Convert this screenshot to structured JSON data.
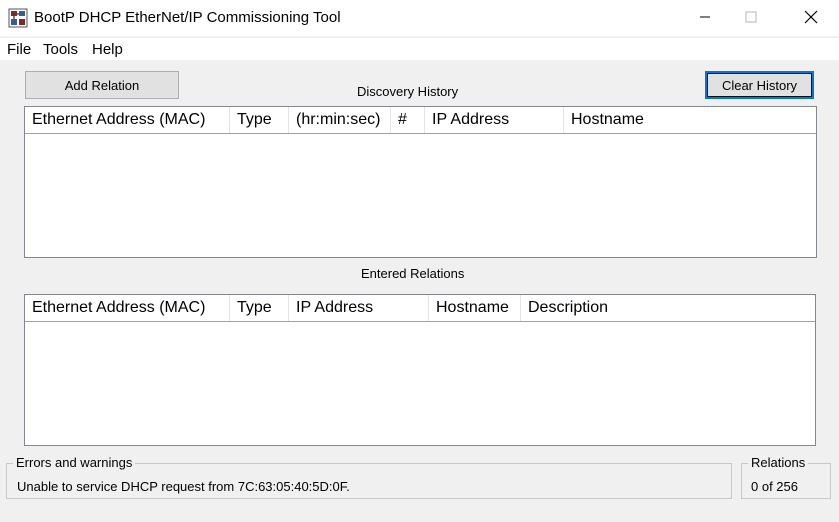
{
  "window": {
    "title": "BootP DHCP EtherNet/IP Commissioning Tool",
    "controls": {
      "minimize": "minimize-icon",
      "maximize": "maximize-icon",
      "close": "close-icon"
    }
  },
  "menu": [
    "File",
    "Tools",
    "Help"
  ],
  "toolbar": {
    "add_relation_label": "Add Relation",
    "clear_history_label": "Clear History"
  },
  "discovery_history": {
    "label": "Discovery History",
    "columns": [
      "Ethernet Address (MAC)",
      "Type",
      "(hr:min:sec)",
      "#",
      "IP Address",
      "Hostname"
    ],
    "rows": []
  },
  "entered_relations": {
    "label": "Entered Relations",
    "columns": [
      "Ethernet Address (MAC)",
      "Type",
      "IP Address",
      "Hostname",
      "Description"
    ],
    "rows": []
  },
  "status": {
    "errors_label": "Errors and warnings",
    "errors_message": "Unable to service DHCP request from 7C:63:05:40:5D:0F.",
    "relations_label": "Relations",
    "relations_count": "0 of 256"
  },
  "colors": {
    "window_bg": "#f0f0f0",
    "focus_border": "#0078d7",
    "list_bg": "#ffffff"
  }
}
